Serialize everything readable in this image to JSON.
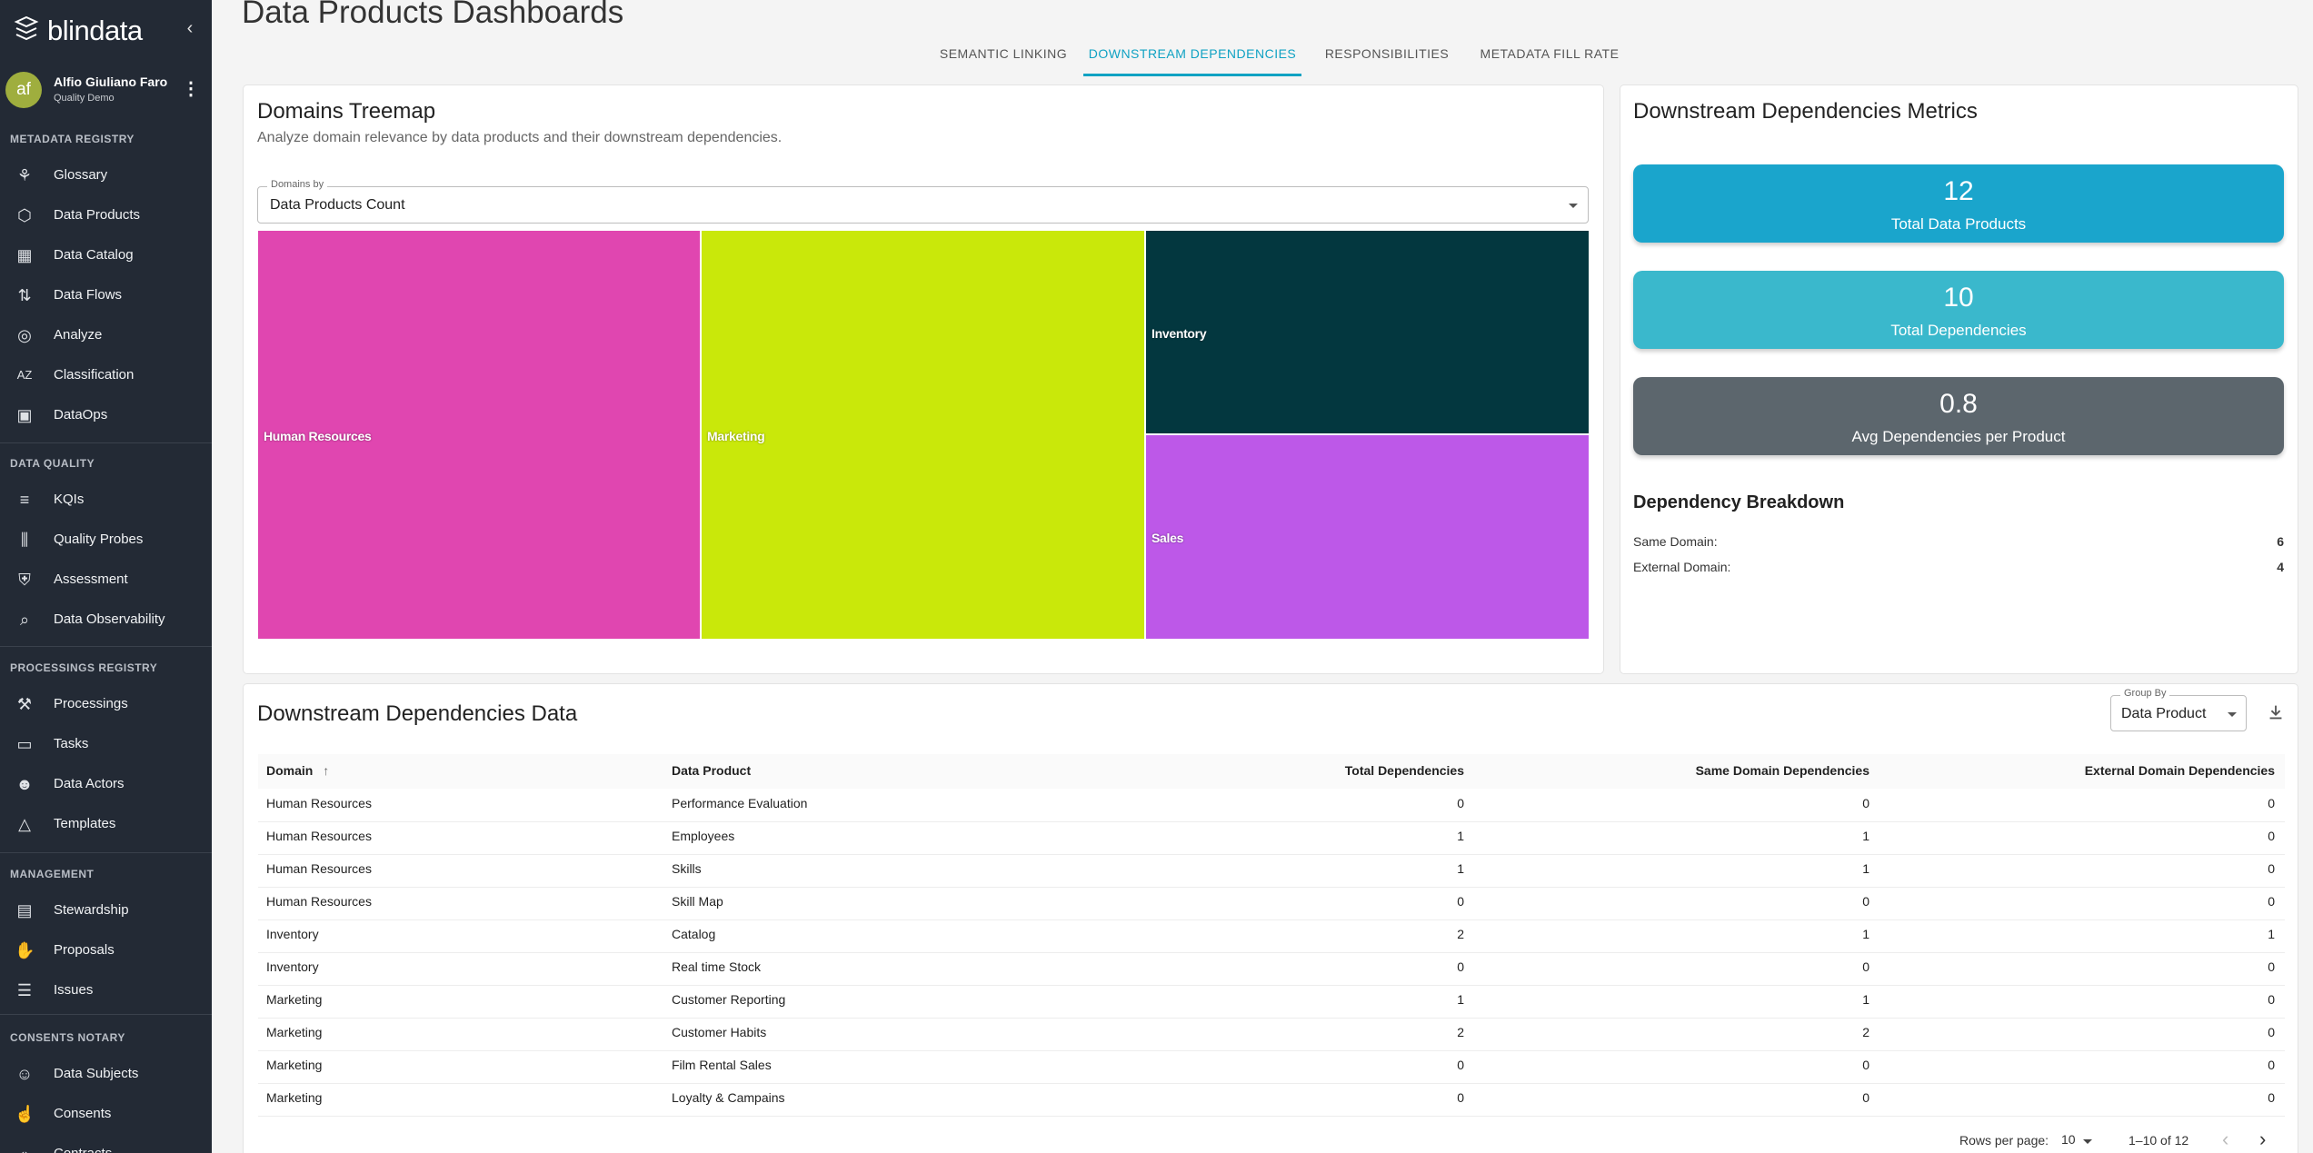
{
  "app": {
    "logo_text": "blindata"
  },
  "user": {
    "initials": "af",
    "name": "Alfio Giuliano Faro",
    "org": "Quality Demo"
  },
  "sidebar": {
    "sections": [
      {
        "title": "METADATA REGISTRY",
        "items": [
          {
            "label": "Glossary",
            "icon": "glossary-icon"
          },
          {
            "label": "Data Products",
            "icon": "hexagon-icon"
          },
          {
            "label": "Data Catalog",
            "icon": "building-icon"
          },
          {
            "label": "Data Flows",
            "icon": "flow-icon"
          },
          {
            "label": "Analyze",
            "icon": "compass-icon"
          },
          {
            "label": "Classification",
            "icon": "az-icon"
          },
          {
            "label": "DataOps",
            "icon": "dev-icon"
          }
        ]
      },
      {
        "title": "DATA QUALITY",
        "items": [
          {
            "label": "KQIs",
            "icon": "signal-icon"
          },
          {
            "label": "Quality Probes",
            "icon": "probes-icon"
          },
          {
            "label": "Assessment",
            "icon": "shield-icon"
          },
          {
            "label": "Data Observability",
            "icon": "search-graph-icon"
          }
        ]
      },
      {
        "title": "PROCESSINGS REGISTRY",
        "items": [
          {
            "label": "Processings",
            "icon": "gavel-icon"
          },
          {
            "label": "Tasks",
            "icon": "briefcase-icon"
          },
          {
            "label": "Data Actors",
            "icon": "people-icon"
          },
          {
            "label": "Templates",
            "icon": "shapes-icon"
          }
        ]
      },
      {
        "title": "MANAGEMENT",
        "items": [
          {
            "label": "Stewardship",
            "icon": "badge-icon"
          },
          {
            "label": "Proposals",
            "icon": "thumbs-icon"
          },
          {
            "label": "Issues",
            "icon": "list-icon"
          }
        ]
      },
      {
        "title": "CONSENTS NOTARY",
        "items": [
          {
            "label": "Data Subjects",
            "icon": "face-icon"
          },
          {
            "label": "Consents",
            "icon": "thumb-up-icon"
          },
          {
            "label": "Contracts",
            "icon": "code-icon"
          }
        ]
      }
    ]
  },
  "page": {
    "title": "Data Products Dashboards",
    "tabs": [
      "SEMANTIC LINKING",
      "DOWNSTREAM DEPENDENCIES",
      "RESPONSIBILITIES",
      "METADATA FILL RATE"
    ],
    "active_tab": 1
  },
  "treemap_card": {
    "title": "Domains Treemap",
    "subtitle": "Analyze domain relevance by data products and their downstream dependencies.",
    "select_label": "Domains by",
    "select_value": "Data Products Count",
    "cells": [
      {
        "label": "Human Resources",
        "value": 4,
        "color": "#e046b0"
      },
      {
        "label": "Marketing",
        "value": 4,
        "color": "#c9e80a"
      },
      {
        "label": "Inventory",
        "value": 2,
        "color": "#03373f"
      },
      {
        "label": "Sales",
        "value": 2,
        "color": "#bd58e8"
      }
    ]
  },
  "metrics_card": {
    "title": "Downstream Dependencies Metrics",
    "metrics": [
      {
        "value": "12",
        "label": "Total Data Products",
        "color": "#1aa5cc"
      },
      {
        "value": "10",
        "label": "Total Dependencies",
        "color": "#3ab8cc"
      },
      {
        "value": "0.8",
        "label": "Avg Dependencies per Product",
        "color": "#5c666d"
      }
    ],
    "breakdown_title": "Dependency Breakdown",
    "breakdown": [
      {
        "label": "Same Domain:",
        "value": "6"
      },
      {
        "label": "External Domain:",
        "value": "4"
      }
    ]
  },
  "table_card": {
    "title": "Downstream Dependencies Data",
    "group_by_label": "Group By",
    "group_by_value": "Data Product",
    "columns": [
      "Domain",
      "Data Product",
      "Total Dependencies",
      "Same Domain Dependencies",
      "External Domain Dependencies"
    ],
    "rows": [
      [
        "Human Resources",
        "Performance Evaluation",
        "0",
        "0",
        "0"
      ],
      [
        "Human Resources",
        "Employees",
        "1",
        "1",
        "0"
      ],
      [
        "Human Resources",
        "Skills",
        "1",
        "1",
        "0"
      ],
      [
        "Human Resources",
        "Skill Map",
        "0",
        "0",
        "0"
      ],
      [
        "Inventory",
        "Catalog",
        "2",
        "1",
        "1"
      ],
      [
        "Inventory",
        "Real time Stock",
        "0",
        "0",
        "0"
      ],
      [
        "Marketing",
        "Customer Reporting",
        "1",
        "1",
        "0"
      ],
      [
        "Marketing",
        "Customer Habits",
        "2",
        "2",
        "0"
      ],
      [
        "Marketing",
        "Film Rental Sales",
        "0",
        "0",
        "0"
      ],
      [
        "Marketing",
        "Loyalty & Campains",
        "0",
        "0",
        "0"
      ]
    ],
    "rows_per_page_label": "Rows per page:",
    "rows_per_page": "10",
    "pagination": "1–10 of 12"
  }
}
